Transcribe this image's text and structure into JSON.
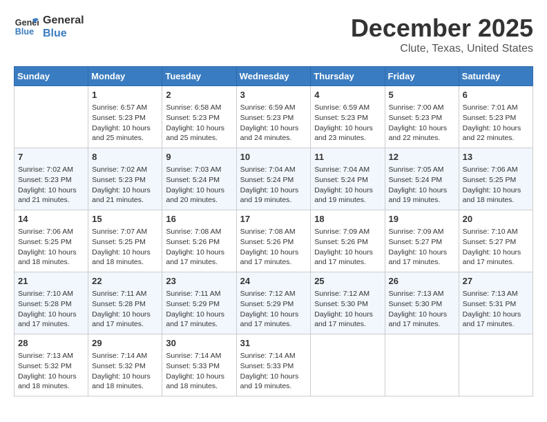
{
  "header": {
    "logo_line1": "General",
    "logo_line2": "Blue",
    "title": "December 2025",
    "subtitle": "Clute, Texas, United States"
  },
  "days_of_week": [
    "Sunday",
    "Monday",
    "Tuesday",
    "Wednesday",
    "Thursday",
    "Friday",
    "Saturday"
  ],
  "weeks": [
    [
      {
        "day": "",
        "sunrise": "",
        "sunset": "",
        "daylight": ""
      },
      {
        "day": "1",
        "sunrise": "Sunrise: 6:57 AM",
        "sunset": "Sunset: 5:23 PM",
        "daylight": "Daylight: 10 hours and 25 minutes."
      },
      {
        "day": "2",
        "sunrise": "Sunrise: 6:58 AM",
        "sunset": "Sunset: 5:23 PM",
        "daylight": "Daylight: 10 hours and 25 minutes."
      },
      {
        "day": "3",
        "sunrise": "Sunrise: 6:59 AM",
        "sunset": "Sunset: 5:23 PM",
        "daylight": "Daylight: 10 hours and 24 minutes."
      },
      {
        "day": "4",
        "sunrise": "Sunrise: 6:59 AM",
        "sunset": "Sunset: 5:23 PM",
        "daylight": "Daylight: 10 hours and 23 minutes."
      },
      {
        "day": "5",
        "sunrise": "Sunrise: 7:00 AM",
        "sunset": "Sunset: 5:23 PM",
        "daylight": "Daylight: 10 hours and 22 minutes."
      },
      {
        "day": "6",
        "sunrise": "Sunrise: 7:01 AM",
        "sunset": "Sunset: 5:23 PM",
        "daylight": "Daylight: 10 hours and 22 minutes."
      }
    ],
    [
      {
        "day": "7",
        "sunrise": "Sunrise: 7:02 AM",
        "sunset": "Sunset: 5:23 PM",
        "daylight": "Daylight: 10 hours and 21 minutes."
      },
      {
        "day": "8",
        "sunrise": "Sunrise: 7:02 AM",
        "sunset": "Sunset: 5:23 PM",
        "daylight": "Daylight: 10 hours and 21 minutes."
      },
      {
        "day": "9",
        "sunrise": "Sunrise: 7:03 AM",
        "sunset": "Sunset: 5:24 PM",
        "daylight": "Daylight: 10 hours and 20 minutes."
      },
      {
        "day": "10",
        "sunrise": "Sunrise: 7:04 AM",
        "sunset": "Sunset: 5:24 PM",
        "daylight": "Daylight: 10 hours and 19 minutes."
      },
      {
        "day": "11",
        "sunrise": "Sunrise: 7:04 AM",
        "sunset": "Sunset: 5:24 PM",
        "daylight": "Daylight: 10 hours and 19 minutes."
      },
      {
        "day": "12",
        "sunrise": "Sunrise: 7:05 AM",
        "sunset": "Sunset: 5:24 PM",
        "daylight": "Daylight: 10 hours and 19 minutes."
      },
      {
        "day": "13",
        "sunrise": "Sunrise: 7:06 AM",
        "sunset": "Sunset: 5:25 PM",
        "daylight": "Daylight: 10 hours and 18 minutes."
      }
    ],
    [
      {
        "day": "14",
        "sunrise": "Sunrise: 7:06 AM",
        "sunset": "Sunset: 5:25 PM",
        "daylight": "Daylight: 10 hours and 18 minutes."
      },
      {
        "day": "15",
        "sunrise": "Sunrise: 7:07 AM",
        "sunset": "Sunset: 5:25 PM",
        "daylight": "Daylight: 10 hours and 18 minutes."
      },
      {
        "day": "16",
        "sunrise": "Sunrise: 7:08 AM",
        "sunset": "Sunset: 5:26 PM",
        "daylight": "Daylight: 10 hours and 17 minutes."
      },
      {
        "day": "17",
        "sunrise": "Sunrise: 7:08 AM",
        "sunset": "Sunset: 5:26 PM",
        "daylight": "Daylight: 10 hours and 17 minutes."
      },
      {
        "day": "18",
        "sunrise": "Sunrise: 7:09 AM",
        "sunset": "Sunset: 5:26 PM",
        "daylight": "Daylight: 10 hours and 17 minutes."
      },
      {
        "day": "19",
        "sunrise": "Sunrise: 7:09 AM",
        "sunset": "Sunset: 5:27 PM",
        "daylight": "Daylight: 10 hours and 17 minutes."
      },
      {
        "day": "20",
        "sunrise": "Sunrise: 7:10 AM",
        "sunset": "Sunset: 5:27 PM",
        "daylight": "Daylight: 10 hours and 17 minutes."
      }
    ],
    [
      {
        "day": "21",
        "sunrise": "Sunrise: 7:10 AM",
        "sunset": "Sunset: 5:28 PM",
        "daylight": "Daylight: 10 hours and 17 minutes."
      },
      {
        "day": "22",
        "sunrise": "Sunrise: 7:11 AM",
        "sunset": "Sunset: 5:28 PM",
        "daylight": "Daylight: 10 hours and 17 minutes."
      },
      {
        "day": "23",
        "sunrise": "Sunrise: 7:11 AM",
        "sunset": "Sunset: 5:29 PM",
        "daylight": "Daylight: 10 hours and 17 minutes."
      },
      {
        "day": "24",
        "sunrise": "Sunrise: 7:12 AM",
        "sunset": "Sunset: 5:29 PM",
        "daylight": "Daylight: 10 hours and 17 minutes."
      },
      {
        "day": "25",
        "sunrise": "Sunrise: 7:12 AM",
        "sunset": "Sunset: 5:30 PM",
        "daylight": "Daylight: 10 hours and 17 minutes."
      },
      {
        "day": "26",
        "sunrise": "Sunrise: 7:13 AM",
        "sunset": "Sunset: 5:30 PM",
        "daylight": "Daylight: 10 hours and 17 minutes."
      },
      {
        "day": "27",
        "sunrise": "Sunrise: 7:13 AM",
        "sunset": "Sunset: 5:31 PM",
        "daylight": "Daylight: 10 hours and 17 minutes."
      }
    ],
    [
      {
        "day": "28",
        "sunrise": "Sunrise: 7:13 AM",
        "sunset": "Sunset: 5:32 PM",
        "daylight": "Daylight: 10 hours and 18 minutes."
      },
      {
        "day": "29",
        "sunrise": "Sunrise: 7:14 AM",
        "sunset": "Sunset: 5:32 PM",
        "daylight": "Daylight: 10 hours and 18 minutes."
      },
      {
        "day": "30",
        "sunrise": "Sunrise: 7:14 AM",
        "sunset": "Sunset: 5:33 PM",
        "daylight": "Daylight: 10 hours and 18 minutes."
      },
      {
        "day": "31",
        "sunrise": "Sunrise: 7:14 AM",
        "sunset": "Sunset: 5:33 PM",
        "daylight": "Daylight: 10 hours and 19 minutes."
      },
      {
        "day": "",
        "sunrise": "",
        "sunset": "",
        "daylight": ""
      },
      {
        "day": "",
        "sunrise": "",
        "sunset": "",
        "daylight": ""
      },
      {
        "day": "",
        "sunrise": "",
        "sunset": "",
        "daylight": ""
      }
    ]
  ]
}
